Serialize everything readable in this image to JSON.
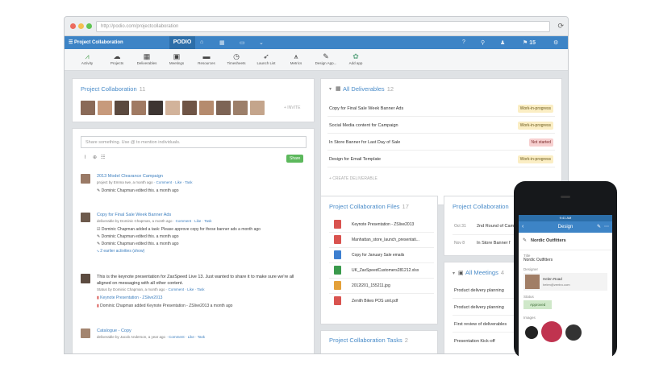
{
  "browser": {
    "url": "http://podio.com/projectcollaboration"
  },
  "nav": {
    "workspace": "Project Collaboration",
    "logo": "PODIO",
    "count": "15"
  },
  "apps": [
    {
      "icon": "activity-icon",
      "glyph": "⩘",
      "label": "Activity"
    },
    {
      "icon": "projects-icon",
      "glyph": "☁",
      "label": "Projects"
    },
    {
      "icon": "deliverables-icon",
      "glyph": "▦",
      "label": "Deliverables"
    },
    {
      "icon": "meetings-icon",
      "glyph": "▣",
      "label": "Meetings"
    },
    {
      "icon": "resources-icon",
      "glyph": "▬",
      "label": "Resources"
    },
    {
      "icon": "timesheets-icon",
      "glyph": "◷",
      "label": "Timesheets"
    },
    {
      "icon": "launch-list-icon",
      "glyph": "➶",
      "label": "Launch List"
    },
    {
      "icon": "metrics-icon",
      "glyph": "⩚",
      "label": "Metrics"
    },
    {
      "icon": "design-app-icon",
      "glyph": "✎",
      "label": "Design App..."
    },
    {
      "icon": "add-app-icon",
      "glyph": "✿",
      "label": "Add app"
    }
  ],
  "members": {
    "title": "Project Collaboration",
    "count": "11",
    "invite": "+ INVITE",
    "avatar_colors": [
      "#8a6a58",
      "#c79a7c",
      "#5b4a3f",
      "#a07a63",
      "#3d3532",
      "#d2b39b",
      "#6f5546",
      "#b58b6e",
      "#7d6455",
      "#9c7f6a",
      "#c4a58c"
    ]
  },
  "share": {
    "placeholder": "Share something. Use @ to mention individuals.",
    "button": "Share"
  },
  "activity": [
    {
      "title": "2013 Model Clearance Campaign",
      "sub": "project by Emma Iwe, a month ago",
      "links": "· Comment · Like · Task",
      "edits": [
        "Dominic Chapman edited this. a month ago"
      ],
      "more": ""
    },
    {
      "title": "Copy for Final Sale Week Banner Ads",
      "sub": "deliverable by Dominic Chapman, a month ago",
      "links": "· Comment · Like · Task",
      "edits": [
        "Dominic Chapman added a task: Please approve copy for these banner ads  a month ago",
        "Dominic Chapman edited this. a month ago",
        "Dominic Chapman edited this. a month ago"
      ],
      "more": "2 earlier activities (show)"
    },
    {
      "title": "This is the keynote presentation for ZaxSpeed Live 13. Just wanted to share it to make sure we're all aligned on messaging with all other content.",
      "sub": "Status by Dominic Chapman, a month ago",
      "links": "· Comment · Like · Task",
      "file": "Keynote Presentation - ZSlive2013",
      "edits": [
        "Dominic Chapman added Keynote Presentation - ZSlive2013  a month ago"
      ],
      "more": ""
    },
    {
      "title": "Catalogue - Copy",
      "sub": "deliverable by Jacob Anderson, a year ago",
      "links": "· Comment · Like · Task",
      "edits": [],
      "more": ""
    }
  ],
  "deliverables": {
    "title": "All Deliverables",
    "count": "12",
    "create": "+ CREATE DELIVERABLE",
    "rows": [
      {
        "name": "Copy for Final Sale Week Banner Ads",
        "status": "Work-in-progress",
        "kind": "wip"
      },
      {
        "name": "Social Media content for Campaign",
        "status": "Work-in-progress",
        "kind": "wip"
      },
      {
        "name": "In Store Banner for Last Day of Sale",
        "status": "Not started",
        "kind": "ns"
      },
      {
        "name": "Design for Email Template",
        "status": "Work-in-progress",
        "kind": "wip"
      }
    ]
  },
  "files": {
    "title": "Project Collaboration Files",
    "count": "17",
    "items": [
      {
        "name": "Keynote Presentation - ZSlive2013",
        "color": "#d9534f"
      },
      {
        "name": "Manhattan_store_launch_presentati...",
        "color": "#d9534f"
      },
      {
        "name": "Copy for January Sale emails",
        "color": "#3d7fd0"
      },
      {
        "name": "UK_ZaxSpeedCustomers281212.xlsx",
        "color": "#3a9a4c"
      },
      {
        "name": "2012l201_155211.jpg",
        "color": "#e4a13a"
      },
      {
        "name": "Zenith Bikes POS unit.pdf",
        "color": "#d9534f"
      }
    ]
  },
  "tasks": {
    "title": "Project Collaboration Tasks",
    "count": "2"
  },
  "dates": {
    "title": "Project Collaboration",
    "rows": [
      {
        "date": "Oct 31",
        "text": "2nd Round of Cam"
      },
      {
        "date": "Nov 8",
        "text": "In Store Banner f"
      }
    ]
  },
  "meetings": {
    "title": "All Meetings",
    "count": "4",
    "rows": [
      "Product delivery planning",
      "Product delivery planning",
      "First review of deliverables",
      "Presentation Kick-off"
    ]
  },
  "phone": {
    "time": "9:41 AM",
    "header": "Design",
    "crumb": "Nordic Outfitters",
    "field_title_label": "Title",
    "field_title": "Nordic Outfitters",
    "designer_label": "Designer",
    "designer_name": "Helen Road",
    "designer_email": "helen@zentro.com",
    "status_label": "Status",
    "status": "Approved",
    "images_label": "Images"
  }
}
